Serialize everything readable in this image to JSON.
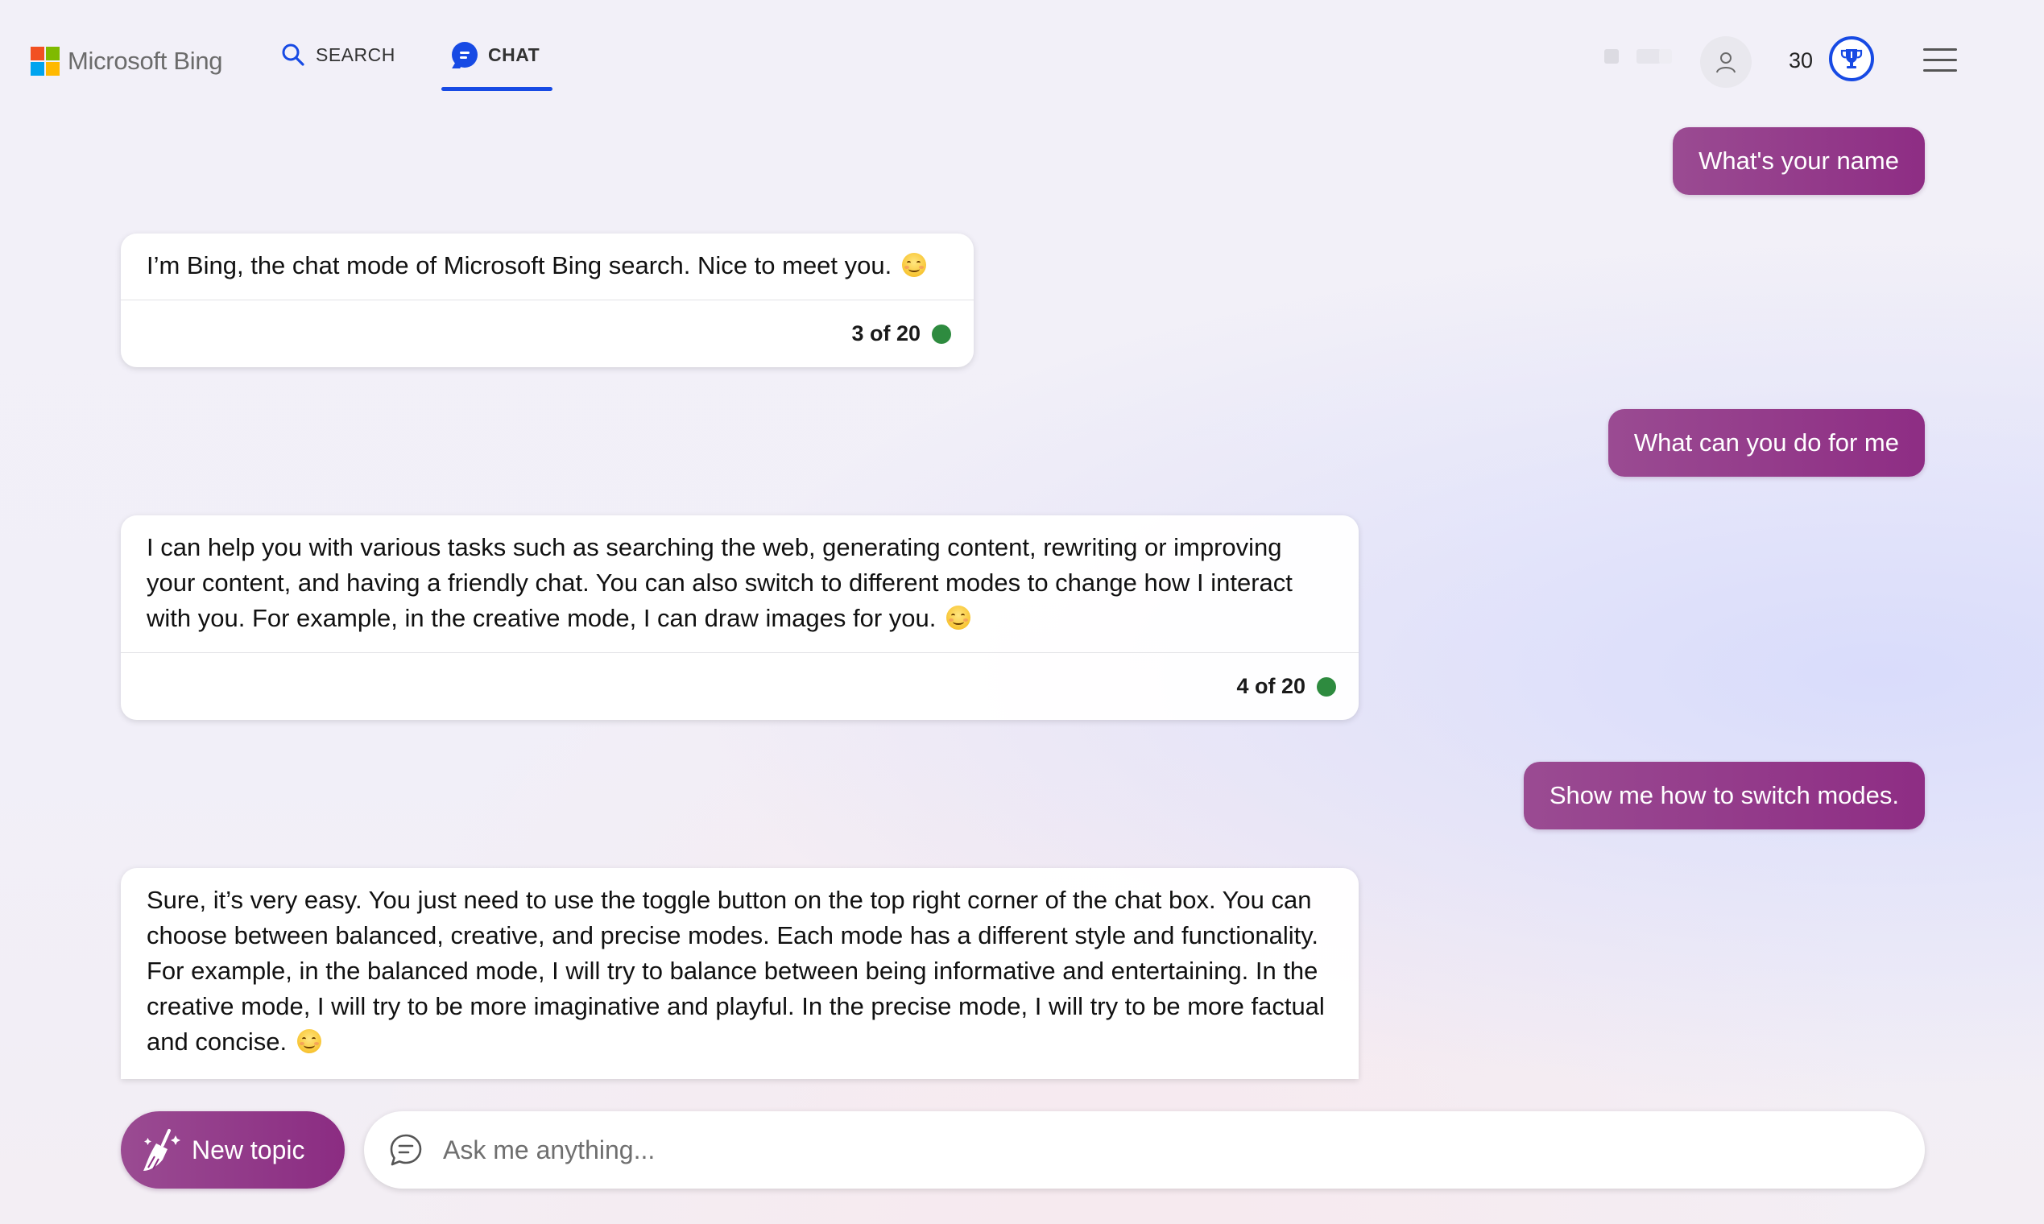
{
  "header": {
    "brand": "Microsoft Bing",
    "nav": {
      "search_label": "SEARCH",
      "chat_label": "CHAT",
      "active": "CHAT"
    },
    "points": "30",
    "icons": [
      "search-icon",
      "chat-icon",
      "user-icon",
      "trophy-icon",
      "hamburger-menu-icon"
    ]
  },
  "colors": {
    "accent_blue": "#174ae4",
    "user_bubble": "#8e2d84",
    "status_green": "#2e8b3f",
    "ms_logo": [
      "#f25022",
      "#7fba00",
      "#00a4ef",
      "#ffb900"
    ]
  },
  "conversation": [
    {
      "role": "user",
      "text": "What's your name"
    },
    {
      "role": "bot",
      "text": "I’m Bing, the chat mode of Microsoft Bing search. Nice to meet you.",
      "counter": "3 of 20"
    },
    {
      "role": "user",
      "text": "What can you do for me"
    },
    {
      "role": "bot",
      "text": "I can help you with various tasks such as searching the web, generating content, rewriting or improving your content, and having a friendly chat. You can also switch to different modes to change how I interact with you. For example, in the creative mode, I can draw images for you.",
      "counter": "4 of 20"
    },
    {
      "role": "user",
      "text": "Show me how to switch modes."
    },
    {
      "role": "bot",
      "text": "Sure, it’s very easy. You just need to use the toggle button on the top right corner of the chat box. You can choose between balanced, creative, and precise modes. Each mode has a different style and functionality. For example, in the balanced mode, I will try to balance between being informative and entertaining. In the creative mode, I will try to be more imaginative and playful. In the precise mode, I will try to be more factual and concise."
    }
  ],
  "composer": {
    "new_topic_label": "New topic",
    "placeholder": "Ask me anything..."
  }
}
